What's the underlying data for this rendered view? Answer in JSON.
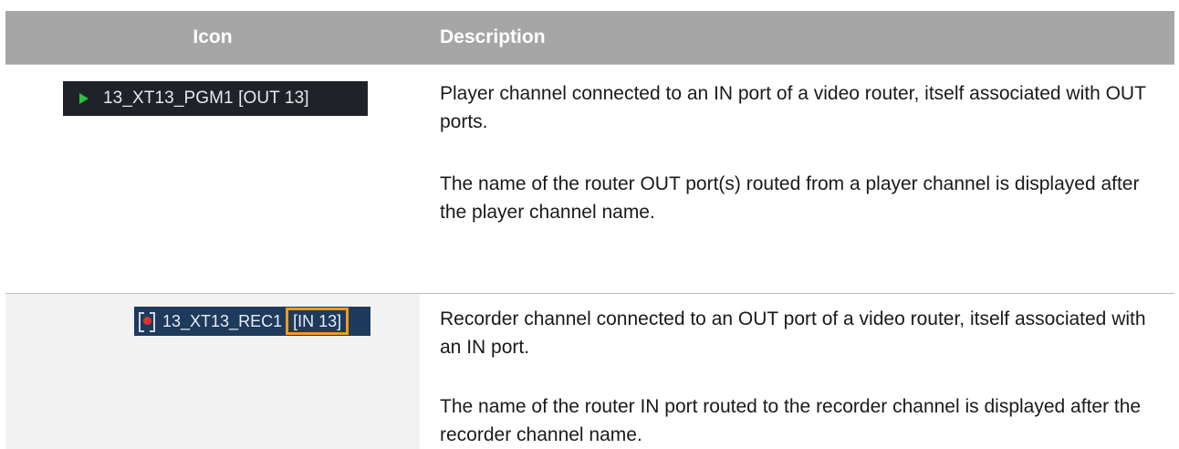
{
  "header": {
    "icon_label": "Icon",
    "description_label": "Description"
  },
  "rows": [
    {
      "icon": {
        "type": "player-channel",
        "channel_name": "13_XT13_PGM1 [OUT 13]",
        "play_color": "#2fbf3f"
      },
      "paragraphs": [
        "Player channel connected to an IN port of a video router, itself associated with OUT ports.",
        "The name of the router OUT port(s) routed from a player channel is displayed after the player channel name."
      ]
    },
    {
      "icon": {
        "type": "recorder-channel",
        "channel_name": "13_XT13_REC1",
        "port_label": "[IN 13]",
        "highlight_color": "#f39a1e",
        "record_color": "#e53030"
      },
      "paragraphs": [
        "Recorder channel connected to an OUT port of a video router, itself associated with an IN port.",
        "The name of the router IN port routed to the recorder channel is displayed after the recorder channel name."
      ]
    }
  ]
}
